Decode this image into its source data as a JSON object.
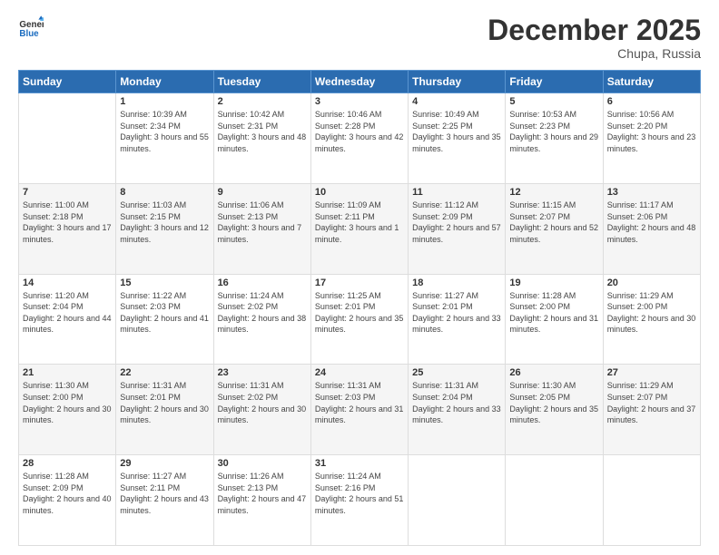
{
  "logo": {
    "general": "General",
    "blue": "Blue"
  },
  "title": "December 2025",
  "location": "Chupa, Russia",
  "days_header": [
    "Sunday",
    "Monday",
    "Tuesday",
    "Wednesday",
    "Thursday",
    "Friday",
    "Saturday"
  ],
  "weeks": [
    [
      {
        "day": "",
        "sunrise": "",
        "sunset": "",
        "daylight": ""
      },
      {
        "day": "1",
        "sunrise": "Sunrise: 10:39 AM",
        "sunset": "Sunset: 2:34 PM",
        "daylight": "Daylight: 3 hours and 55 minutes."
      },
      {
        "day": "2",
        "sunrise": "Sunrise: 10:42 AM",
        "sunset": "Sunset: 2:31 PM",
        "daylight": "Daylight: 3 hours and 48 minutes."
      },
      {
        "day": "3",
        "sunrise": "Sunrise: 10:46 AM",
        "sunset": "Sunset: 2:28 PM",
        "daylight": "Daylight: 3 hours and 42 minutes."
      },
      {
        "day": "4",
        "sunrise": "Sunrise: 10:49 AM",
        "sunset": "Sunset: 2:25 PM",
        "daylight": "Daylight: 3 hours and 35 minutes."
      },
      {
        "day": "5",
        "sunrise": "Sunrise: 10:53 AM",
        "sunset": "Sunset: 2:23 PM",
        "daylight": "Daylight: 3 hours and 29 minutes."
      },
      {
        "day": "6",
        "sunrise": "Sunrise: 10:56 AM",
        "sunset": "Sunset: 2:20 PM",
        "daylight": "Daylight: 3 hours and 23 minutes."
      }
    ],
    [
      {
        "day": "7",
        "sunrise": "Sunrise: 11:00 AM",
        "sunset": "Sunset: 2:18 PM",
        "daylight": "Daylight: 3 hours and 17 minutes."
      },
      {
        "day": "8",
        "sunrise": "Sunrise: 11:03 AM",
        "sunset": "Sunset: 2:15 PM",
        "daylight": "Daylight: 3 hours and 12 minutes."
      },
      {
        "day": "9",
        "sunrise": "Sunrise: 11:06 AM",
        "sunset": "Sunset: 2:13 PM",
        "daylight": "Daylight: 3 hours and 7 minutes."
      },
      {
        "day": "10",
        "sunrise": "Sunrise: 11:09 AM",
        "sunset": "Sunset: 2:11 PM",
        "daylight": "Daylight: 3 hours and 1 minute."
      },
      {
        "day": "11",
        "sunrise": "Sunrise: 11:12 AM",
        "sunset": "Sunset: 2:09 PM",
        "daylight": "Daylight: 2 hours and 57 minutes."
      },
      {
        "day": "12",
        "sunrise": "Sunrise: 11:15 AM",
        "sunset": "Sunset: 2:07 PM",
        "daylight": "Daylight: 2 hours and 52 minutes."
      },
      {
        "day": "13",
        "sunrise": "Sunrise: 11:17 AM",
        "sunset": "Sunset: 2:06 PM",
        "daylight": "Daylight: 2 hours and 48 minutes."
      }
    ],
    [
      {
        "day": "14",
        "sunrise": "Sunrise: 11:20 AM",
        "sunset": "Sunset: 2:04 PM",
        "daylight": "Daylight: 2 hours and 44 minutes."
      },
      {
        "day": "15",
        "sunrise": "Sunrise: 11:22 AM",
        "sunset": "Sunset: 2:03 PM",
        "daylight": "Daylight: 2 hours and 41 minutes."
      },
      {
        "day": "16",
        "sunrise": "Sunrise: 11:24 AM",
        "sunset": "Sunset: 2:02 PM",
        "daylight": "Daylight: 2 hours and 38 minutes."
      },
      {
        "day": "17",
        "sunrise": "Sunrise: 11:25 AM",
        "sunset": "Sunset: 2:01 PM",
        "daylight": "Daylight: 2 hours and 35 minutes."
      },
      {
        "day": "18",
        "sunrise": "Sunrise: 11:27 AM",
        "sunset": "Sunset: 2:01 PM",
        "daylight": "Daylight: 2 hours and 33 minutes."
      },
      {
        "day": "19",
        "sunrise": "Sunrise: 11:28 AM",
        "sunset": "Sunset: 2:00 PM",
        "daylight": "Daylight: 2 hours and 31 minutes."
      },
      {
        "day": "20",
        "sunrise": "Sunrise: 11:29 AM",
        "sunset": "Sunset: 2:00 PM",
        "daylight": "Daylight: 2 hours and 30 minutes."
      }
    ],
    [
      {
        "day": "21",
        "sunrise": "Sunrise: 11:30 AM",
        "sunset": "Sunset: 2:00 PM",
        "daylight": "Daylight: 2 hours and 30 minutes."
      },
      {
        "day": "22",
        "sunrise": "Sunrise: 11:31 AM",
        "sunset": "Sunset: 2:01 PM",
        "daylight": "Daylight: 2 hours and 30 minutes."
      },
      {
        "day": "23",
        "sunrise": "Sunrise: 11:31 AM",
        "sunset": "Sunset: 2:02 PM",
        "daylight": "Daylight: 2 hours and 30 minutes."
      },
      {
        "day": "24",
        "sunrise": "Sunrise: 11:31 AM",
        "sunset": "Sunset: 2:03 PM",
        "daylight": "Daylight: 2 hours and 31 minutes."
      },
      {
        "day": "25",
        "sunrise": "Sunrise: 11:31 AM",
        "sunset": "Sunset: 2:04 PM",
        "daylight": "Daylight: 2 hours and 33 minutes."
      },
      {
        "day": "26",
        "sunrise": "Sunrise: 11:30 AM",
        "sunset": "Sunset: 2:05 PM",
        "daylight": "Daylight: 2 hours and 35 minutes."
      },
      {
        "day": "27",
        "sunrise": "Sunrise: 11:29 AM",
        "sunset": "Sunset: 2:07 PM",
        "daylight": "Daylight: 2 hours and 37 minutes."
      }
    ],
    [
      {
        "day": "28",
        "sunrise": "Sunrise: 11:28 AM",
        "sunset": "Sunset: 2:09 PM",
        "daylight": "Daylight: 2 hours and 40 minutes."
      },
      {
        "day": "29",
        "sunrise": "Sunrise: 11:27 AM",
        "sunset": "Sunset: 2:11 PM",
        "daylight": "Daylight: 2 hours and 43 minutes."
      },
      {
        "day": "30",
        "sunrise": "Sunrise: 11:26 AM",
        "sunset": "Sunset: 2:13 PM",
        "daylight": "Daylight: 2 hours and 47 minutes."
      },
      {
        "day": "31",
        "sunrise": "Sunrise: 11:24 AM",
        "sunset": "Sunset: 2:16 PM",
        "daylight": "Daylight: 2 hours and 51 minutes."
      },
      {
        "day": "",
        "sunrise": "",
        "sunset": "",
        "daylight": ""
      },
      {
        "day": "",
        "sunrise": "",
        "sunset": "",
        "daylight": ""
      },
      {
        "day": "",
        "sunrise": "",
        "sunset": "",
        "daylight": ""
      }
    ]
  ]
}
